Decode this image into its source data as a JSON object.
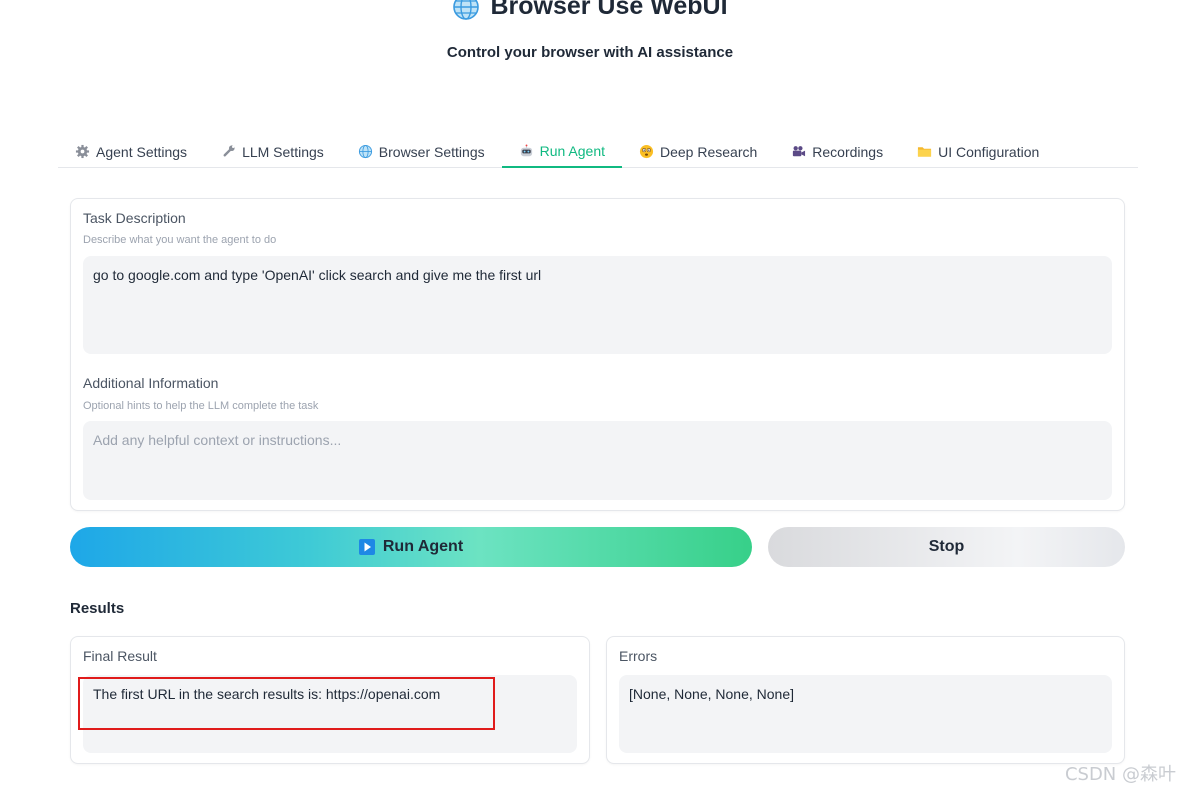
{
  "header": {
    "icon": "globe-icon",
    "title": "Browser Use WebUI",
    "subtitle": "Control your browser with AI assistance"
  },
  "tabs": [
    {
      "label": "Agent Settings",
      "icon": "gear-icon",
      "active": false
    },
    {
      "label": "LLM Settings",
      "icon": "wrench-icon",
      "active": false
    },
    {
      "label": "Browser Settings",
      "icon": "globe-icon",
      "active": false
    },
    {
      "label": "Run Agent",
      "icon": "robot-icon",
      "active": true
    },
    {
      "label": "Deep Research",
      "icon": "face-icon",
      "active": false
    },
    {
      "label": "Recordings",
      "icon": "camera-icon",
      "active": false
    },
    {
      "label": "UI Configuration",
      "icon": "folder-icon",
      "active": false
    }
  ],
  "task": {
    "label": "Task Description",
    "hint": "Describe what you want the agent to do",
    "value": "go to google.com and type 'OpenAI' click search and give me the first url"
  },
  "additional": {
    "label": "Additional Information",
    "hint": "Optional hints to help the LLM complete the task",
    "placeholder": "Add any helpful context or instructions...",
    "value": ""
  },
  "buttons": {
    "run_label": "Run Agent",
    "stop_label": "Stop"
  },
  "results": {
    "heading": "Results",
    "final_label": "Final Result",
    "final_value": "The first URL in the search results is: https://openai.com",
    "errors_label": "Errors",
    "errors_value": "[None, None, None, None]"
  },
  "watermark": "CSDN @森叶",
  "colors": {
    "accent": "#10b981",
    "highlight_border": "#e01b1b"
  }
}
